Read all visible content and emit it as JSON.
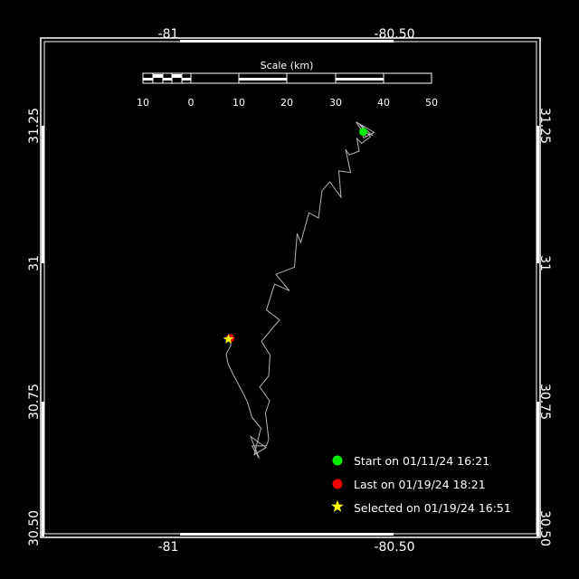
{
  "map": {
    "axes": {
      "lon_labels": [
        "-81",
        "-80.50"
      ],
      "lat_labels": [
        "31.25",
        "31",
        "30.75",
        "30.50"
      ]
    },
    "scale": {
      "title": "Scale (km)",
      "labels": [
        "10",
        "0",
        "10",
        "20",
        "30",
        "40",
        "50"
      ]
    },
    "legend": [
      {
        "label": "Start on 01/11/24 16:21",
        "color": "#00ee00",
        "marker": "circle"
      },
      {
        "label": "Last on 01/19/24 18:21",
        "color": "#ee0000",
        "marker": "circle"
      },
      {
        "label": "Selected on 01/19/24 16:51",
        "color": "#ffff00",
        "marker": "star"
      }
    ],
    "track_color": "#b4b4b4",
    "track": [
      [
        -80.563,
        31.23
      ],
      [
        -80.585,
        31.257
      ],
      [
        -80.545,
        31.238
      ],
      [
        -80.568,
        31.228
      ],
      [
        -80.575,
        31.243
      ],
      [
        -80.548,
        31.232
      ],
      [
        -80.58,
        31.255
      ],
      [
        -80.553,
        31.23
      ],
      [
        -80.573,
        31.218
      ],
      [
        -80.583,
        31.227
      ],
      [
        -80.578,
        31.204
      ],
      [
        -80.6,
        31.197
      ],
      [
        -80.608,
        31.207
      ],
      [
        -80.597,
        31.165
      ],
      [
        -80.623,
        31.168
      ],
      [
        -80.618,
        31.12
      ],
      [
        -80.643,
        31.148
      ],
      [
        -80.66,
        31.132
      ],
      [
        -80.668,
        31.082
      ],
      [
        -80.689,
        31.092
      ],
      [
        -80.707,
        31.038
      ],
      [
        -80.715,
        31.054
      ],
      [
        -80.721,
        30.993
      ],
      [
        -80.762,
        30.98
      ],
      [
        -80.732,
        30.95
      ],
      [
        -80.765,
        30.962
      ],
      [
        -80.783,
        30.915
      ],
      [
        -80.754,
        30.897
      ],
      [
        -80.794,
        30.858
      ],
      [
        -80.775,
        30.833
      ],
      [
        -80.778,
        30.795
      ],
      [
        -80.798,
        30.775
      ],
      [
        -80.776,
        30.75
      ],
      [
        -80.785,
        30.728
      ],
      [
        -80.778,
        30.68
      ],
      [
        -80.783,
        30.668
      ],
      [
        -80.815,
        30.668
      ],
      [
        -80.799,
        30.645
      ],
      [
        -80.818,
        30.685
      ],
      [
        -80.784,
        30.665
      ],
      [
        -80.81,
        30.652
      ],
      [
        -80.8,
        30.685
      ],
      [
        -80.795,
        30.7
      ],
      [
        -80.815,
        30.72
      ],
      [
        -80.825,
        30.748
      ],
      [
        -80.85,
        30.788
      ],
      [
        -80.858,
        30.8
      ],
      [
        -80.868,
        30.818
      ],
      [
        -80.872,
        30.835
      ],
      [
        -80.862,
        30.85
      ],
      [
        -80.862,
        30.864
      ]
    ],
    "start": [
      -80.569,
      31.239
    ],
    "last": [
      -80.863,
      30.864
    ],
    "selected": [
      -80.867,
      30.862
    ]
  }
}
